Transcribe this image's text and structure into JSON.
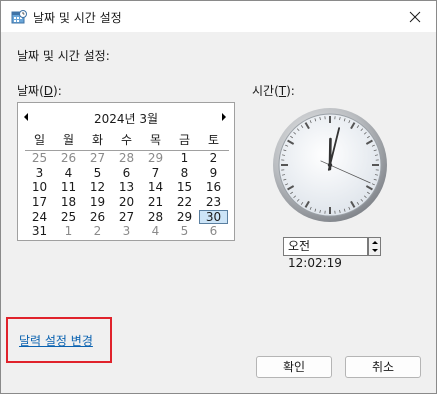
{
  "window": {
    "title": "날짜 및 시간 설정",
    "icon": "date-time-settings-icon",
    "close_icon": "close-icon"
  },
  "heading": "날짜 및 시간 설정:",
  "date_label": {
    "text": "날짜",
    "access_key": "D"
  },
  "time_label": {
    "text": "시간",
    "access_key": "T"
  },
  "calendar": {
    "month_title": "2024년 3월",
    "weekdays": [
      "일",
      "월",
      "화",
      "수",
      "목",
      "금",
      "토"
    ],
    "weeks": [
      [
        "25",
        "26",
        "27",
        "28",
        "29",
        "1",
        "2"
      ],
      [
        "3",
        "4",
        "5",
        "6",
        "7",
        "8",
        "9"
      ],
      [
        "10",
        "11",
        "12",
        "13",
        "14",
        "15",
        "16"
      ],
      [
        "17",
        "18",
        "19",
        "20",
        "21",
        "22",
        "23"
      ],
      [
        "24",
        "25",
        "26",
        "27",
        "28",
        "29",
        "30"
      ],
      [
        "31",
        "1",
        "2",
        "3",
        "4",
        "5",
        "6"
      ]
    ],
    "selected_day": "30"
  },
  "clock": {
    "hour": 12,
    "minute": 2,
    "second": 19
  },
  "time_value": "오전 12:02:19",
  "change_calendar_link": "달력 설정 변경",
  "buttons": {
    "ok": "확인",
    "cancel": "취소"
  }
}
